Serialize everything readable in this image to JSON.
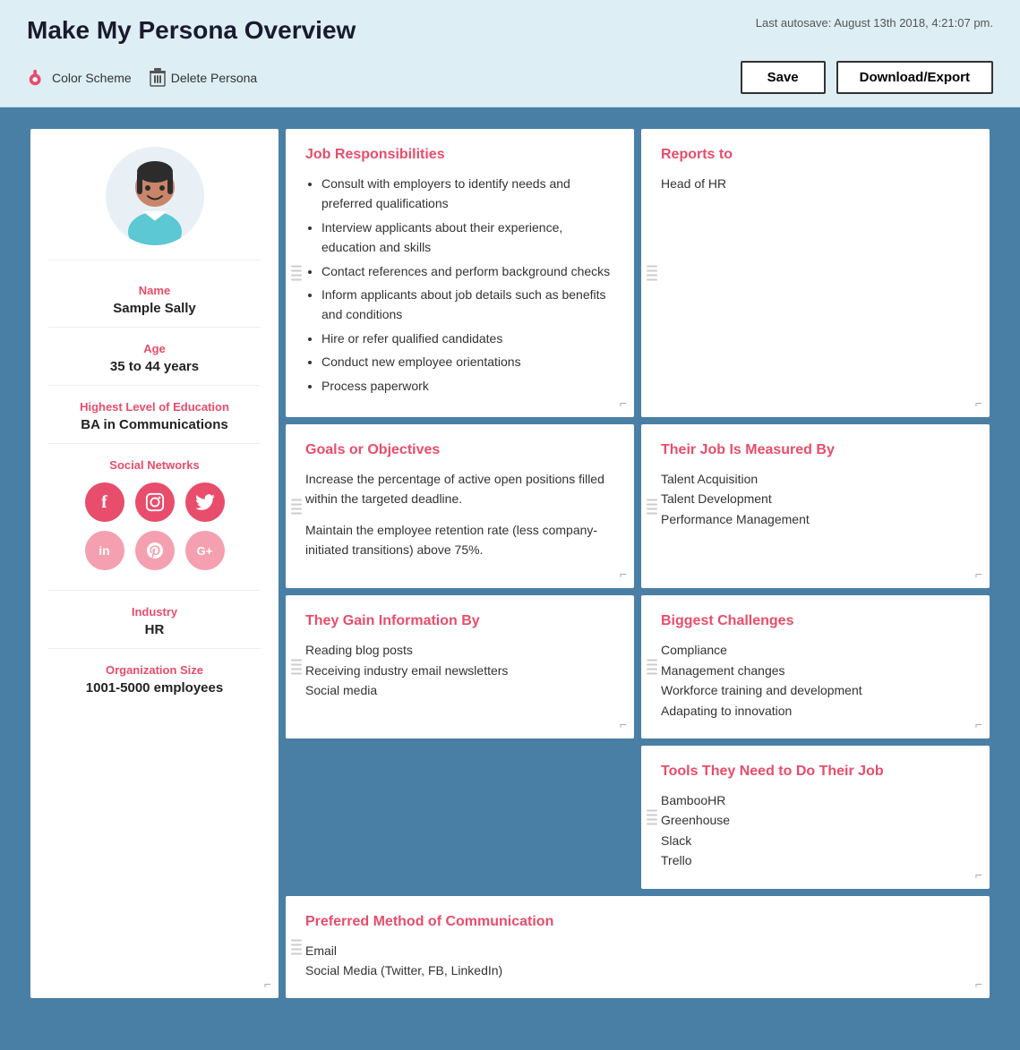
{
  "header": {
    "title": "Make My Persona Overview",
    "autosave": "Last autosave: August 13th 2018, 4:21:07 pm.",
    "colorScheme": "Color Scheme",
    "deletePersona": "Delete Persona",
    "saveLabel": "Save",
    "downloadLabel": "Download/Export"
  },
  "persona": {
    "nameLabel": "Name",
    "nameValue": "Sample Sally",
    "ageLabel": "Age",
    "ageValue": "35 to 44 years",
    "educationLabel": "Highest Level of Education",
    "educationValue": "BA in Communications",
    "socialLabel": "Social Networks",
    "industryLabel": "Industry",
    "industryValue": "HR",
    "orgSizeLabel": "Organization Size",
    "orgSizeValue": "1001-5000 employees"
  },
  "cards": {
    "jobResponsibilities": {
      "title": "Job Responsibilities",
      "items": [
        "Consult with employers to identify needs and preferred qualifications",
        "Interview applicants about their experience, education and skills",
        "Contact references and perform background checks",
        "Inform applicants about job details such as benefits and conditions",
        "Hire or refer qualified candidates",
        "Conduct new employee orientations",
        "Process paperwork"
      ]
    },
    "reportsTo": {
      "title": "Reports to",
      "value": "Head of HR"
    },
    "jobMeasured": {
      "title": "Their Job Is Measured By",
      "items": [
        "Talent Acquisition",
        "Talent Development",
        "Performance Management"
      ]
    },
    "goals": {
      "title": "Goals or Objectives",
      "paragraphs": [
        "Increase the percentage of active open positions filled within the targeted deadline.",
        "Maintain the employee retention rate (less company-initiated transitions) above 75%."
      ]
    },
    "challenges": {
      "title": "Biggest Challenges",
      "items": [
        "Compliance",
        "Management changes",
        "Workforce training and development",
        "Adapating to innovation"
      ]
    },
    "gainInfo": {
      "title": "They Gain Information By",
      "items": [
        "Reading blog posts",
        "Receiving industry email newsletters",
        "Social media"
      ]
    },
    "tools": {
      "title": "Tools They Need to Do Their Job",
      "items": [
        "BambooHR",
        "Greenhouse",
        "Slack",
        "Trello"
      ]
    },
    "communication": {
      "title": "Preferred Method of Communication",
      "items": [
        "Email",
        "Social Media (Twitter, FB, LinkedIn)"
      ]
    }
  },
  "social": {
    "icons": [
      "f",
      "📷",
      "🐦",
      "in",
      "℗",
      "G+"
    ]
  },
  "colors": {
    "accent": "#e84d6b",
    "background": "#4a7fa5",
    "headerBg": "#ddeef5"
  }
}
